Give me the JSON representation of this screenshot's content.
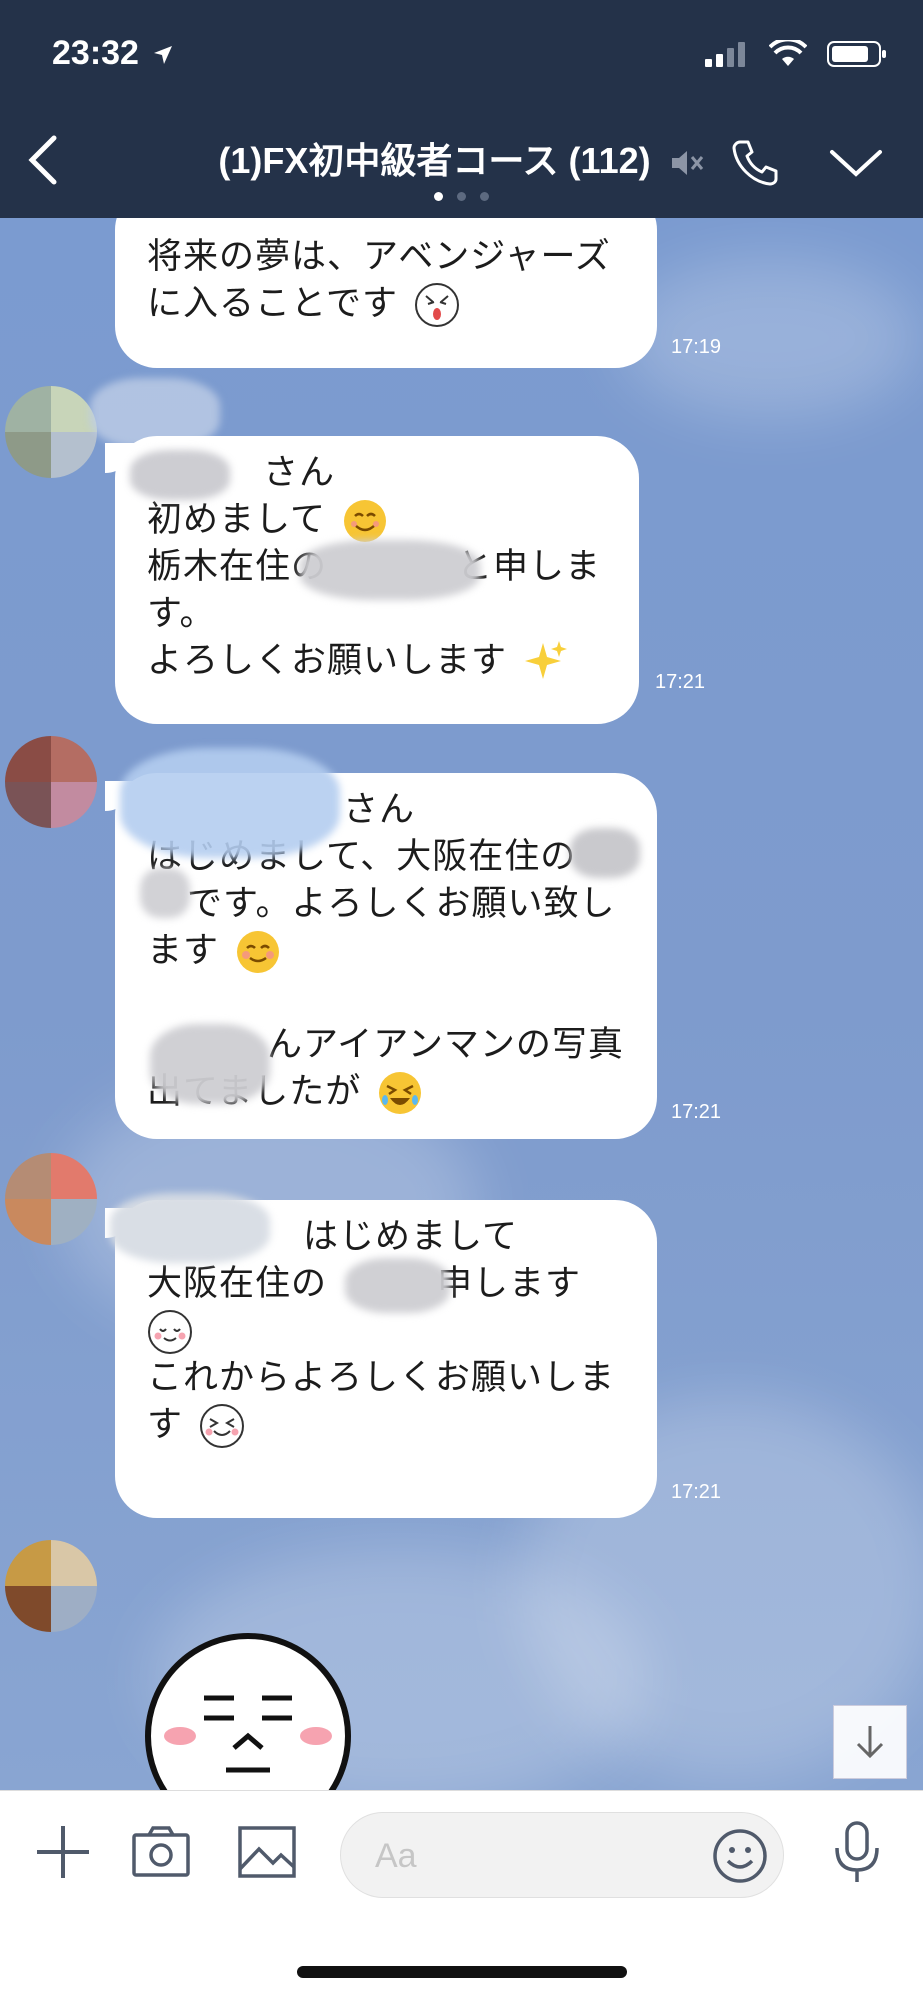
{
  "status": {
    "time": "23:32"
  },
  "header": {
    "title": "(1)FX初中級者コース (112)",
    "page_dots": 3,
    "bg_color": "#243249"
  },
  "messages": [
    {
      "lines": [
        "将来の夢は、アベンジャーズ",
        "に入ることです"
      ],
      "emoji": "line-surprised-emoji",
      "time": "17:19"
    },
    {
      "lines": [
        "さん",
        "初めまして",
        "栃木在住の",
        "と申しま",
        "す。",
        "よろしくお願いします"
      ],
      "time": "17:21"
    },
    {
      "lines": [
        "さん",
        "はじめまして、大阪在住の",
        "です。よろしくお願い致し",
        "ます",
        "んアイアンマンの写真",
        "出てましたが"
      ],
      "time": "17:21"
    },
    {
      "lines": [
        "はじめまして",
        "大阪在住の",
        "申します",
        "これからよろしくお願いしま",
        "す"
      ],
      "time": "17:21"
    }
  ],
  "input": {
    "placeholder": "Aa"
  },
  "icons": [
    "back-icon",
    "mute-icon",
    "phone-icon",
    "chevron-down-icon",
    "plus-icon",
    "camera-icon",
    "image-icon",
    "emoji-icon",
    "mic-icon",
    "scroll-down-icon"
  ]
}
